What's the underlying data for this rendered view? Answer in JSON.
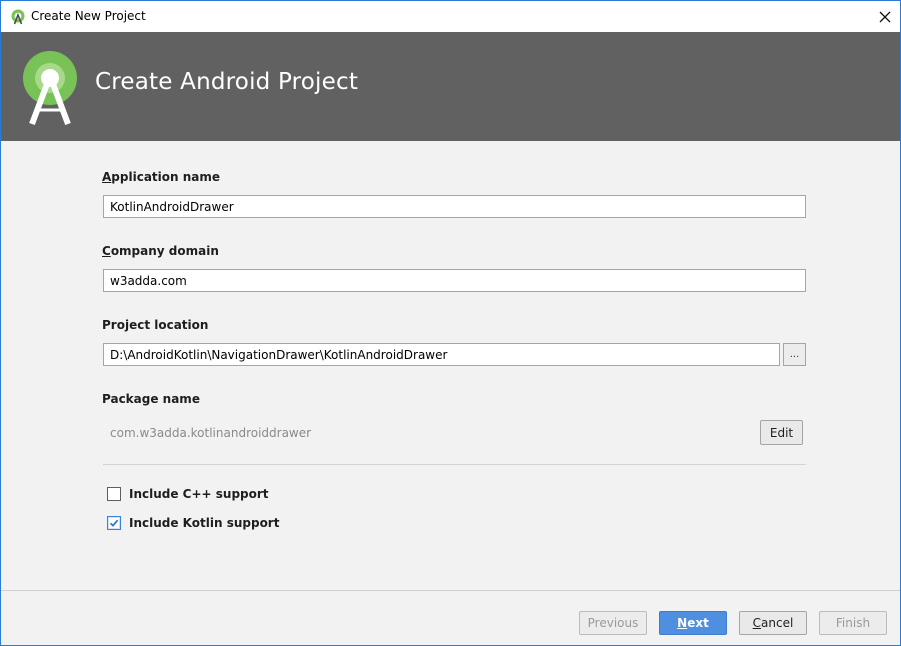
{
  "window": {
    "title": "Create New Project"
  },
  "header": {
    "title": "Create Android Project"
  },
  "form": {
    "app_name": {
      "label_first": "A",
      "label_rest": "pplication name",
      "value": "KotlinAndroidDrawer"
    },
    "company_domain": {
      "label_first": "C",
      "label_rest": "ompany domain",
      "value": "w3adda.com"
    },
    "project_location": {
      "label": "Project location",
      "value": "D:\\AndroidKotlin\\NavigationDrawer\\KotlinAndroidDrawer",
      "browse_label": "..."
    },
    "package_name": {
      "label": "Package name",
      "value": "com.w3adda.kotlinandroiddrawer",
      "edit_label": "Edit"
    },
    "include_cpp": {
      "label": "Include C++ support",
      "checked": false
    },
    "include_kotlin": {
      "label": "Include Kotlin support",
      "checked": true
    }
  },
  "footer": {
    "previous_label": "Previous",
    "next_first": "N",
    "next_rest": "ext",
    "cancel_first": "C",
    "cancel_rest": "ancel",
    "finish_label": "Finish"
  },
  "colors": {
    "header_bg": "#616161",
    "android_green": "#78c257",
    "primary_button": "#4e8fe0",
    "window_border": "#2b7bd4"
  },
  "icons": {
    "title": "android-studio-icon",
    "close": "close-icon",
    "logo": "android-studio-logo",
    "check": "checkmark-icon"
  }
}
